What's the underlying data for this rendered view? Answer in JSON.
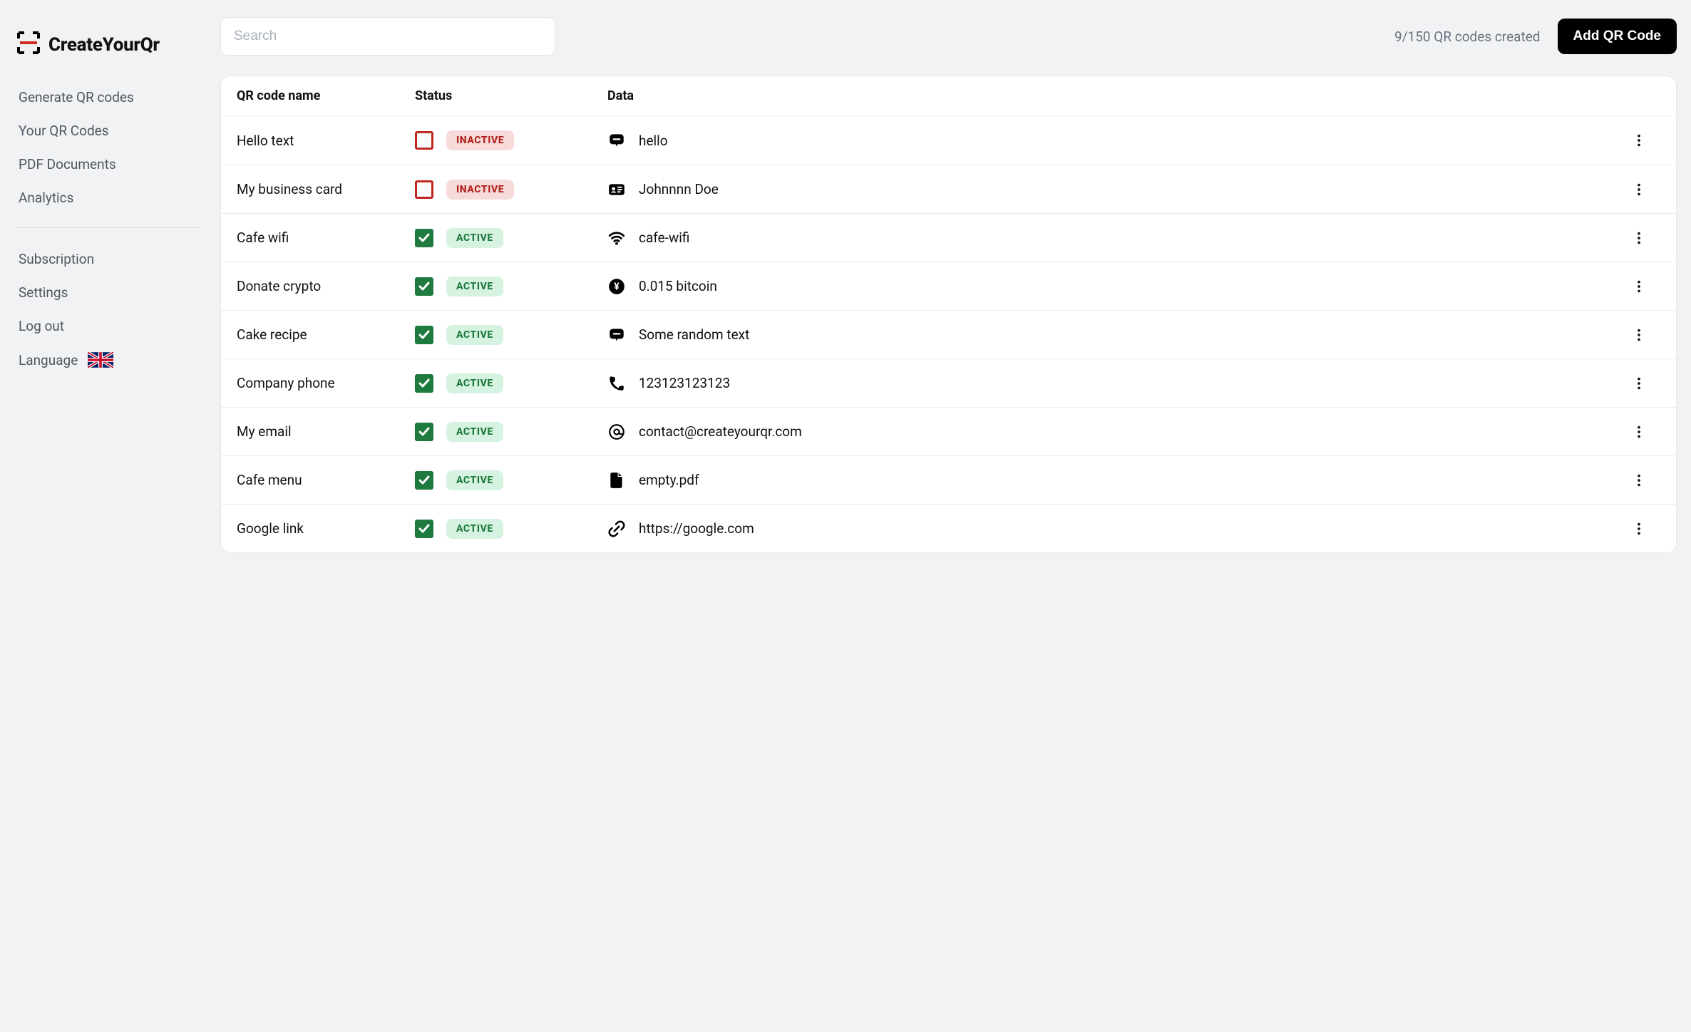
{
  "brand": {
    "name": "CreateYourQr"
  },
  "sidebar": {
    "primary": [
      {
        "label": "Generate QR codes"
      },
      {
        "label": "Your QR Codes"
      },
      {
        "label": "PDF Documents"
      },
      {
        "label": "Analytics"
      }
    ],
    "secondary": [
      {
        "label": "Subscription"
      },
      {
        "label": "Settings"
      },
      {
        "label": "Log out"
      },
      {
        "label": "Language"
      }
    ]
  },
  "topbar": {
    "search_placeholder": "Search",
    "count_text": "9/150 QR codes created",
    "add_button": "Add QR Code"
  },
  "table": {
    "headers": {
      "name": "QR code name",
      "status": "Status",
      "data": "Data"
    },
    "status_labels": {
      "active": "ACTIVE",
      "inactive": "INACTIVE"
    },
    "rows": [
      {
        "name": "Hello text",
        "active": false,
        "icon": "message",
        "data": "hello"
      },
      {
        "name": "My business card",
        "active": false,
        "icon": "card",
        "data": "Johnnnn Doe"
      },
      {
        "name": "Cafe wifi",
        "active": true,
        "icon": "wifi",
        "data": "cafe-wifi"
      },
      {
        "name": "Donate crypto",
        "active": true,
        "icon": "coin",
        "data": "0.015 bitcoin"
      },
      {
        "name": "Cake recipe",
        "active": true,
        "icon": "message",
        "data": "Some random text"
      },
      {
        "name": "Company phone",
        "active": true,
        "icon": "phone",
        "data": "123123123123"
      },
      {
        "name": "My email",
        "active": true,
        "icon": "at",
        "data": "contact@createyourqr.com"
      },
      {
        "name": "Cafe menu",
        "active": true,
        "icon": "file",
        "data": "empty.pdf"
      },
      {
        "name": "Google link",
        "active": true,
        "icon": "link",
        "data": "https://google.com"
      }
    ]
  }
}
